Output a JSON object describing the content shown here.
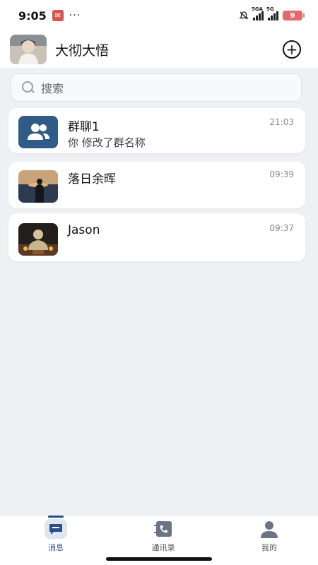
{
  "status_bar": {
    "time": "9:05",
    "network1": "5GA",
    "network2": "5G",
    "battery": "9",
    "dots": "···"
  },
  "header": {
    "title": "大彻大悟",
    "add_icon": "plus-circle-icon"
  },
  "search": {
    "placeholder": "搜索"
  },
  "conversations": [
    {
      "name": "群聊1",
      "message": "你 修改了群名称",
      "time": "21:03",
      "avatar": "group-icon"
    },
    {
      "name": "落日余晖",
      "message": "",
      "time": "09:39",
      "avatar": "sunset-photo"
    },
    {
      "name": "Jason",
      "message": "",
      "time": "09:37",
      "avatar": "statue-photo"
    }
  ],
  "tabs": [
    {
      "label": "消息",
      "icon": "chat-icon",
      "active": true
    },
    {
      "label": "通讯录",
      "icon": "contacts-icon",
      "active": false
    },
    {
      "label": "我的",
      "icon": "person-icon",
      "active": false
    }
  ],
  "colors": {
    "accent": "#2c4f86",
    "group_avatar": "#2f5b86",
    "background": "#eef0f4",
    "battery": "#e36a6a"
  }
}
